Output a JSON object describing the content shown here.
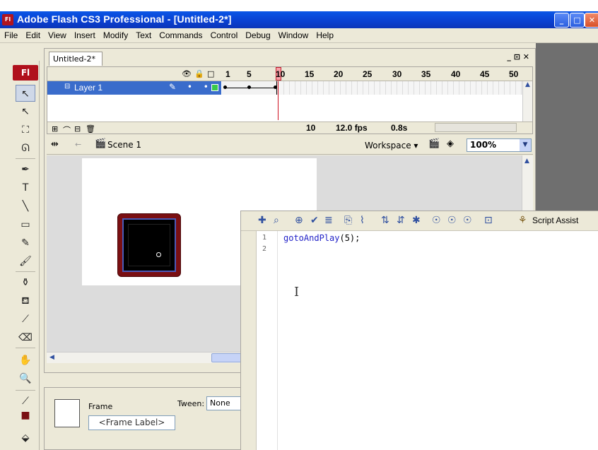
{
  "window": {
    "app_icon": "Fl",
    "title": "Adobe Flash CS3 Professional - [Untitled-2*]",
    "controls": {
      "minimize": "_",
      "maximize": "□",
      "close": "✕"
    }
  },
  "menu": [
    "File",
    "Edit",
    "View",
    "Insert",
    "Modify",
    "Text",
    "Commands",
    "Control",
    "Debug",
    "Window",
    "Help"
  ],
  "tools": {
    "logo": "Fl",
    "items": [
      {
        "name": "selection-tool-icon",
        "glyph": "↖"
      },
      {
        "name": "subselection-tool-icon",
        "glyph": "↖"
      },
      {
        "name": "free-transform-tool-icon",
        "glyph": "⛶"
      },
      {
        "name": "lasso-tool-icon",
        "glyph": "ᘏ"
      },
      {
        "name": "pen-tool-icon",
        "glyph": "✒"
      },
      {
        "name": "text-tool-icon",
        "glyph": "T"
      },
      {
        "name": "line-tool-icon",
        "glyph": "╲"
      },
      {
        "name": "rectangle-tool-icon",
        "glyph": "▭"
      },
      {
        "name": "pencil-tool-icon",
        "glyph": "✎"
      },
      {
        "name": "brush-tool-icon",
        "glyph": "🖌"
      },
      {
        "name": "ink-bottle-tool-icon",
        "glyph": "⚱"
      },
      {
        "name": "paint-bucket-tool-icon",
        "glyph": "⛾"
      },
      {
        "name": "eyedropper-tool-icon",
        "glyph": "⟋"
      },
      {
        "name": "eraser-tool-icon",
        "glyph": "⌫"
      },
      {
        "name": "hand-tool-icon",
        "glyph": "✋"
      },
      {
        "name": "zoom-tool-icon",
        "glyph": "🔍"
      },
      {
        "name": "stroke-color-icon",
        "glyph": "⟋"
      },
      {
        "name": "fill-color-icon",
        "glyph": "■"
      },
      {
        "name": "swap-colors-icon",
        "glyph": "⬙"
      }
    ]
  },
  "document": {
    "tab": "Untitled-2*",
    "window_controls": "_ ⊡ ✕"
  },
  "timeline": {
    "frame_numbers": [
      "1",
      "5",
      "10",
      "15",
      "20",
      "25",
      "30",
      "35",
      "40",
      "45",
      "50"
    ],
    "header_icons": {
      "eye": "👁",
      "lock": "🔒",
      "outline": "□"
    },
    "layer": {
      "name": "Layer 1",
      "icon": "⊟",
      "controls": "✎ • •"
    },
    "status": {
      "current_frame": "10",
      "fps": "12.0 fps",
      "elapsed": "0.8s"
    },
    "bottom_icons": [
      "⊞",
      "⌒",
      "⊟",
      "🗑"
    ]
  },
  "editbar": {
    "scene": "Scene 1",
    "workspace": "Workspace ▾",
    "zoom": "100%"
  },
  "properties": {
    "frame_label": "Frame",
    "frame_placeholder": "<Frame Label>",
    "tween_label": "Tween:",
    "tween_value": "None"
  },
  "actions": {
    "script_assist": "Script Assist",
    "line_numbers": [
      "1",
      "2"
    ],
    "code_fn": "gotoAndPlay",
    "code_rest": "(5);"
  },
  "colors": {
    "title_bar": "#0a3fd0",
    "layer_selected": "#3a6ccb",
    "playhead": "#d01020",
    "symbol_border": "#7a0f12",
    "code_keyword": "#2323c8"
  }
}
